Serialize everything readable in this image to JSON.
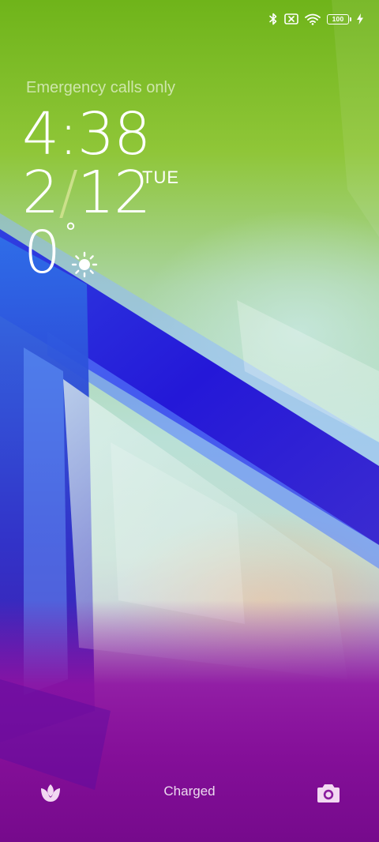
{
  "status_bar": {
    "icons": [
      "bluetooth-icon",
      "no-sim-icon",
      "wifi-icon",
      "battery-icon",
      "charging-bolt-icon"
    ],
    "battery_level": "100"
  },
  "lockscreen": {
    "carrier_text": "Emergency calls only",
    "time": "4:38",
    "date_month": "2",
    "date_separator": "/",
    "date_day": "12",
    "weekday": "TUE",
    "temperature": "0",
    "degree_symbol": "°",
    "weather_icon": "sun-icon"
  },
  "bottom_bar": {
    "left_shortcut_icon": "tulip-icon",
    "charge_status": "Charged",
    "right_shortcut_icon": "camera-icon"
  },
  "colors": {
    "accent_slash": "#cbe08a",
    "text_primary": "#ffffff",
    "icon_tint": "#f2d8f2"
  }
}
